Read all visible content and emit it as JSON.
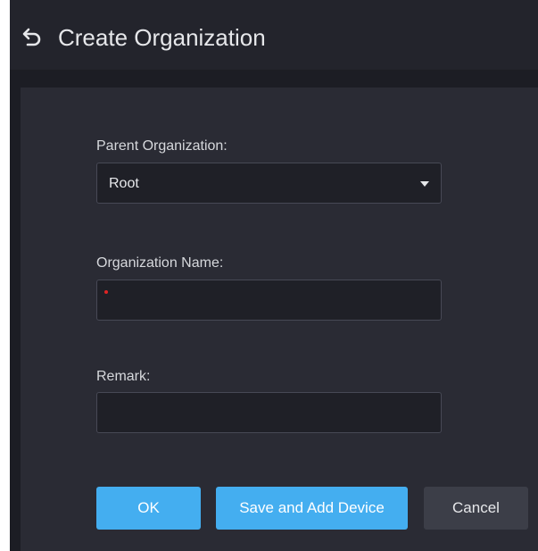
{
  "header": {
    "back_icon": "undo-arrow-icon",
    "title": "Create Organization"
  },
  "form": {
    "parent": {
      "label": "Parent Organization:",
      "selected": "Root",
      "caret_icon": "caret-down-icon"
    },
    "name": {
      "label": "Organization Name:",
      "value": "",
      "required": true
    },
    "remark": {
      "label": "Remark:",
      "value": ""
    }
  },
  "actions": {
    "ok_label": "OK",
    "save_add_label": "Save and Add Device",
    "cancel_label": "Cancel"
  },
  "colors": {
    "accent": "#44aef0",
    "required": "#e02424",
    "panel": "#2a2b34",
    "titlebar": "#23242c"
  }
}
